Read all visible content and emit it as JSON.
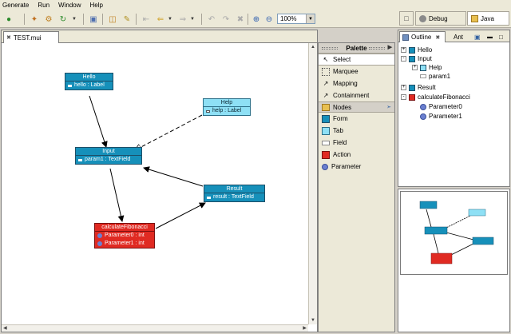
{
  "menu": [
    "Generate",
    "Run",
    "Window",
    "Help"
  ],
  "toolbar": {
    "zoom": "100%",
    "icons": [
      "run-config-icon",
      "new-icon",
      "refresh-icon",
      "settings-icon",
      "open-icon",
      "forward-icon",
      "back-icon",
      "undo-icon",
      "redo-icon",
      "delete-icon",
      "zoom-in-icon",
      "zoom-out-icon"
    ]
  },
  "perspectives": {
    "debug": "Debug",
    "java": "Java"
  },
  "editor": {
    "tab_label": "TEST.mui"
  },
  "diagram": {
    "nodes": {
      "hello": {
        "title": "Hello",
        "rows": [
          "hello : Label"
        ],
        "color": "#1690ba"
      },
      "help": {
        "title": "Help",
        "rows": [
          "help : Label"
        ],
        "color": "#8ee0f5"
      },
      "input": {
        "title": "Input",
        "rows": [
          "param1 : TextField"
        ],
        "color": "#1690ba"
      },
      "result": {
        "title": "Result",
        "rows": [
          "result : TextField"
        ],
        "color": "#1690ba"
      },
      "fib": {
        "title": "calculateFibonacci",
        "rows": [
          "Parameter0 : int",
          "Parameter1 : int"
        ],
        "color": "#e02a22"
      }
    }
  },
  "palette": {
    "title": "Palette",
    "tools": [
      "Select",
      "Marquee",
      "Mapping",
      "Containment"
    ],
    "drawer": "Nodes",
    "nodes": [
      "Form",
      "Tab",
      "Field",
      "Action",
      "Parameter"
    ]
  },
  "outline": {
    "tabs": [
      "Outline",
      "Ant"
    ],
    "tree": [
      {
        "label": "Hello",
        "kind": "teal",
        "indent": 0,
        "expander": "+"
      },
      {
        "label": "Input",
        "kind": "teal",
        "indent": 0,
        "expander": "-"
      },
      {
        "label": "Help",
        "kind": "light",
        "indent": 1,
        "expander": "+"
      },
      {
        "label": "param1",
        "kind": "field",
        "indent": 1,
        "expander": ""
      },
      {
        "label": "Result",
        "kind": "teal",
        "indent": 0,
        "expander": "+"
      },
      {
        "label": "calculateFibonacci",
        "kind": "red",
        "indent": 0,
        "expander": "-"
      },
      {
        "label": "Parameter0",
        "kind": "param",
        "indent": 1,
        "expander": ""
      },
      {
        "label": "Parameter1",
        "kind": "param",
        "indent": 1,
        "expander": ""
      }
    ]
  }
}
